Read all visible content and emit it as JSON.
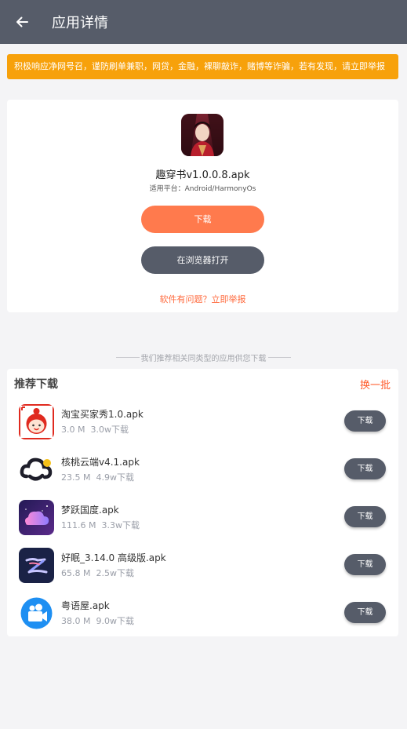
{
  "header": {
    "title": "应用详情"
  },
  "notice": {
    "text": "积极响应净网号召，谨防刷单兼职，网贷，金融，裸聊敲诈，赌博等诈骗，若有发现，请立即举报"
  },
  "app": {
    "name": "趣穿书v1.0.0.8.apk",
    "platform": "适用平台：Android/HarmonyOs",
    "download_label": "下载",
    "browser_label": "在浏览器打开",
    "report_label": "软件有问题？立即举报"
  },
  "recommend": {
    "divider_text": "我们推荐相关同类型的应用供您下载",
    "title": "推荐下载",
    "refresh_label": "换一批",
    "items": [
      {
        "name": "淘宝买家秀1.0.apk",
        "size": "3.0 M",
        "downloads": "3.0w下载",
        "button": "下载",
        "icon": "taobao-avatar-icon"
      },
      {
        "name": "核桃云端v4.1.apk",
        "size": "23.5 M",
        "downloads": "4.9w下载",
        "button": "下载",
        "icon": "cloud-logo-icon"
      },
      {
        "name": "梦跃国度.apk",
        "size": "111.6 M",
        "downloads": "3.3w下载",
        "button": "下载",
        "icon": "dream-cloud-icon"
      },
      {
        "name": "好眠_3.14.0 高级版.apk",
        "size": "65.8 M",
        "downloads": "2.5w下载",
        "button": "下载",
        "icon": "sleep-z-icon"
      },
      {
        "name": "粤语屋.apk",
        "size": "38.0 M",
        "downloads": "9.0w下载",
        "button": "下载",
        "icon": "video-camera-icon"
      }
    ]
  },
  "colors": {
    "topbar": "#565c69",
    "notice": "#f7a10b",
    "accent": "#ff7a4d",
    "report": "#ff6a3d"
  }
}
